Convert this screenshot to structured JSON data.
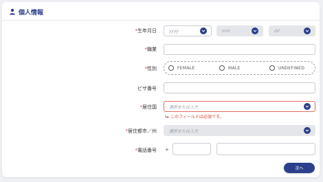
{
  "section": {
    "title": "個人情報",
    "icon": "user-icon"
  },
  "required_mark": "*",
  "birthdate": {
    "label": "生年月日",
    "year_placeholder": "yyyy",
    "month_placeholder": "mm",
    "day_placeholder": "dd"
  },
  "occupation": {
    "label": "職業",
    "value": ""
  },
  "gender": {
    "label": "性別",
    "options": [
      "FEMALE",
      "MALE",
      "UNDEFINED"
    ]
  },
  "visa_number": {
    "label": "ビザ番号",
    "value": ""
  },
  "country": {
    "label": "居住国",
    "placeholder": "選択または入力",
    "error": "このフィールドは必須です。"
  },
  "city_state": {
    "label": "居住都市／州",
    "placeholder": "選択または入力"
  },
  "phone": {
    "label": "電話番号",
    "prefix": "+",
    "code": "",
    "number": ""
  },
  "next_button": {
    "label": "次へ"
  },
  "colors": {
    "accent": "#2b3f8c",
    "error": "#e0413b"
  }
}
